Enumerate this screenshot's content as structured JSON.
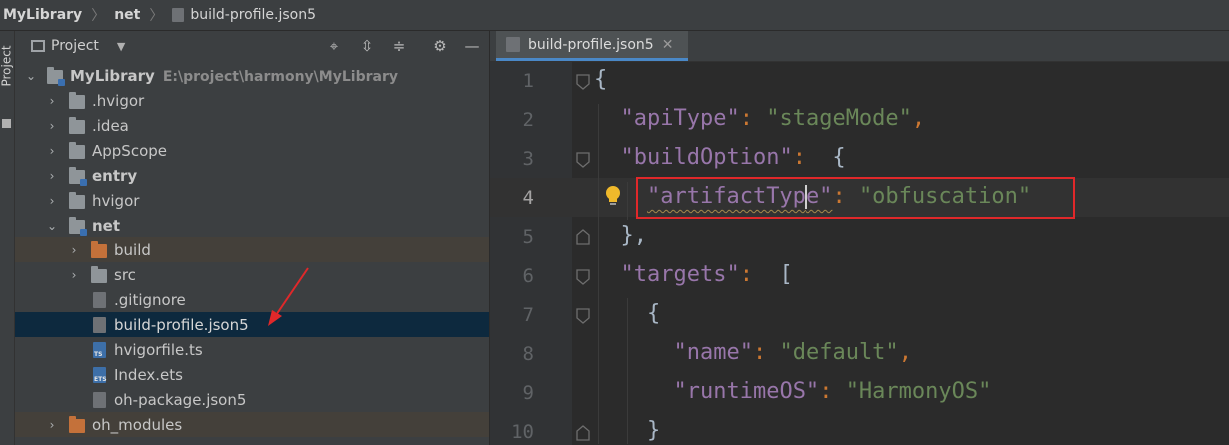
{
  "breadcrumb": {
    "items": [
      "MyLibrary",
      "net",
      "build-profile.json5"
    ]
  },
  "side_strip": {
    "label": "Project"
  },
  "project_panel": {
    "title": "Project",
    "tree": [
      {
        "label": "MyLibrary",
        "path": "E:\\project\\harmony\\MyLibrary",
        "type": "module",
        "expanded": true,
        "bold": true
      },
      {
        "label": ".hvigor",
        "type": "folder"
      },
      {
        "label": ".idea",
        "type": "folder"
      },
      {
        "label": "AppScope",
        "type": "folder"
      },
      {
        "label": "entry",
        "type": "module",
        "bold": true
      },
      {
        "label": "hvigor",
        "type": "folder"
      },
      {
        "label": "net",
        "type": "module",
        "expanded": true,
        "bold": true
      },
      {
        "label": "build",
        "type": "folder-excluded"
      },
      {
        "label": "src",
        "type": "folder"
      },
      {
        "label": ".gitignore",
        "type": "file"
      },
      {
        "label": "build-profile.json5",
        "type": "json5",
        "selected": true
      },
      {
        "label": "hvigorfile.ts",
        "type": "ts"
      },
      {
        "label": "Index.ets",
        "type": "ets"
      },
      {
        "label": "oh-package.json5",
        "type": "json5"
      },
      {
        "label": "oh_modules",
        "type": "folder-excluded"
      }
    ]
  },
  "editor": {
    "tab_label": "build-profile.json5",
    "current_line": 4,
    "line_numbers": [
      "1",
      "2",
      "3",
      "4",
      "5",
      "6",
      "7",
      "8",
      "9",
      "10"
    ],
    "lines": {
      "l1": "{",
      "l2_key": "\"apiType\"",
      "l2_val": "\"stageMode\"",
      "l3_key": "\"buildOption\"",
      "l4_key_a": "\"artifactTyp",
      "l4_key_b": "e\"",
      "l4_val": "\"obfuscation\"",
      "l5": "},",
      "l6_key": "\"targets\"",
      "l7": "{",
      "l8_key": "\"name\"",
      "l8_val": "\"default\"",
      "l9_key": "\"runtimeOS\"",
      "l9_val": "\"HarmonyOS\"",
      "l10": "}"
    },
    "punct": {
      "colon": ": ",
      "comma": ",",
      "open_brace": " {",
      "open_bracket": " ["
    }
  },
  "colors": {
    "key": "#9876aa",
    "string": "#6a8759",
    "punctuation": "#cc7832",
    "highlight_border": "#e0282a",
    "selection": "#0d293e"
  }
}
